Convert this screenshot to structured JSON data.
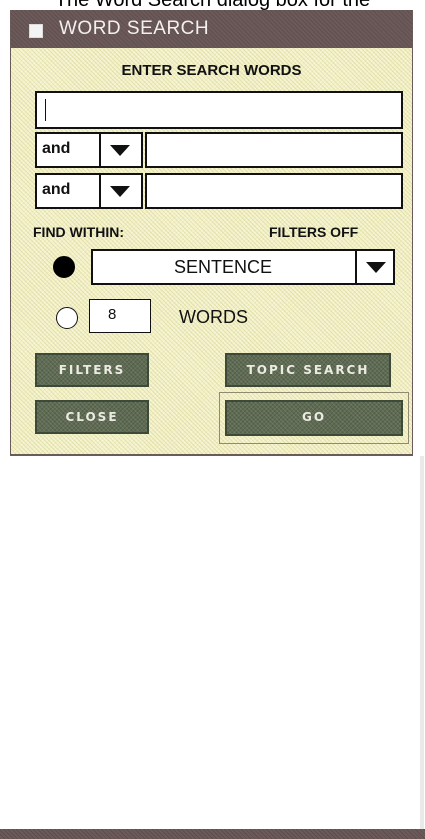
{
  "caption": "The Word Search dialog box for the",
  "dialog": {
    "title": "WORD SEARCH",
    "heading": "ENTER SEARCH WORDS",
    "search_fields": [
      {
        "value": ""
      },
      {
        "operator": "and",
        "value": ""
      },
      {
        "operator": "and",
        "value": ""
      }
    ],
    "find_within_label": "FIND WITHIN:",
    "filters_status": "FILTERS OFF",
    "within_option_selected": "SENTENCE",
    "word_count_value": "8",
    "words_label": "WORDS",
    "buttons": {
      "filters": "FILTERS",
      "topic_search": "TOPIC SEARCH",
      "close": "CLOSE",
      "go": "GO"
    }
  },
  "colors": {
    "titlebar": "#6c5a5a",
    "dialog_bg": "#f3f1c4",
    "button_bg": "#5e6b52"
  }
}
